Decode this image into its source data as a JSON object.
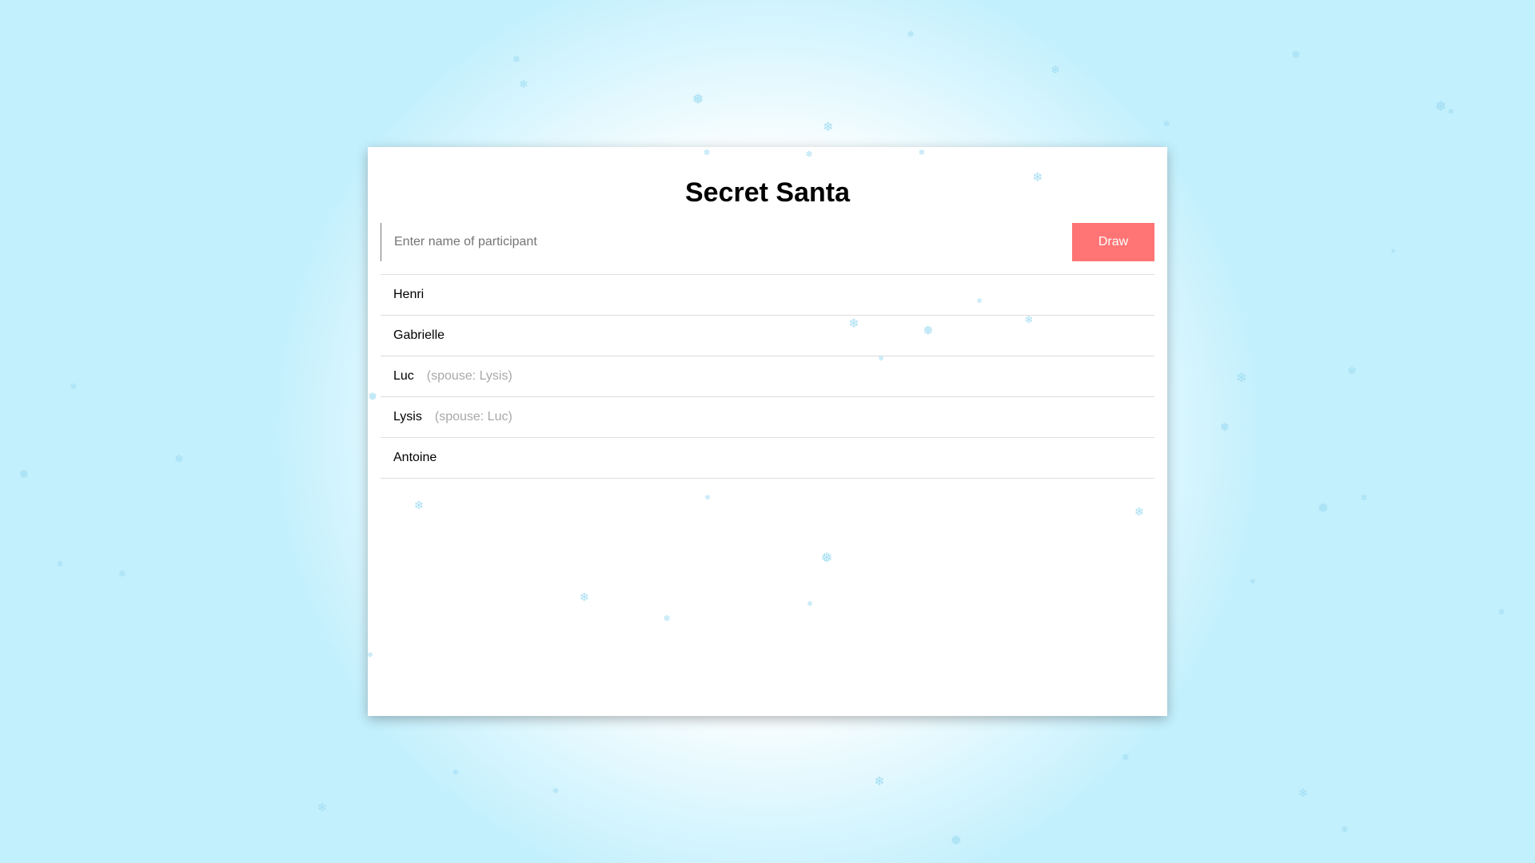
{
  "app": {
    "title": "Secret Santa"
  },
  "input": {
    "placeholder": "Enter name of participant",
    "value": ""
  },
  "draw_button": {
    "label": "Draw"
  },
  "participants": [
    {
      "name": "Henri",
      "spouse_note": ""
    },
    {
      "name": "Gabrielle",
      "spouse_note": ""
    },
    {
      "name": "Luc",
      "spouse_note": "(spouse: Lysis)"
    },
    {
      "name": "Lysis",
      "spouse_note": "(spouse: Luc)"
    },
    {
      "name": "Antoine",
      "spouse_note": ""
    }
  ],
  "colors": {
    "accent": "#ff7474",
    "snow": "#9fdcf2",
    "background_edge": "#c3f0fd",
    "spouse_text": "#a8a8a8"
  },
  "icons": {
    "snowflake": "snowflake-icon"
  }
}
